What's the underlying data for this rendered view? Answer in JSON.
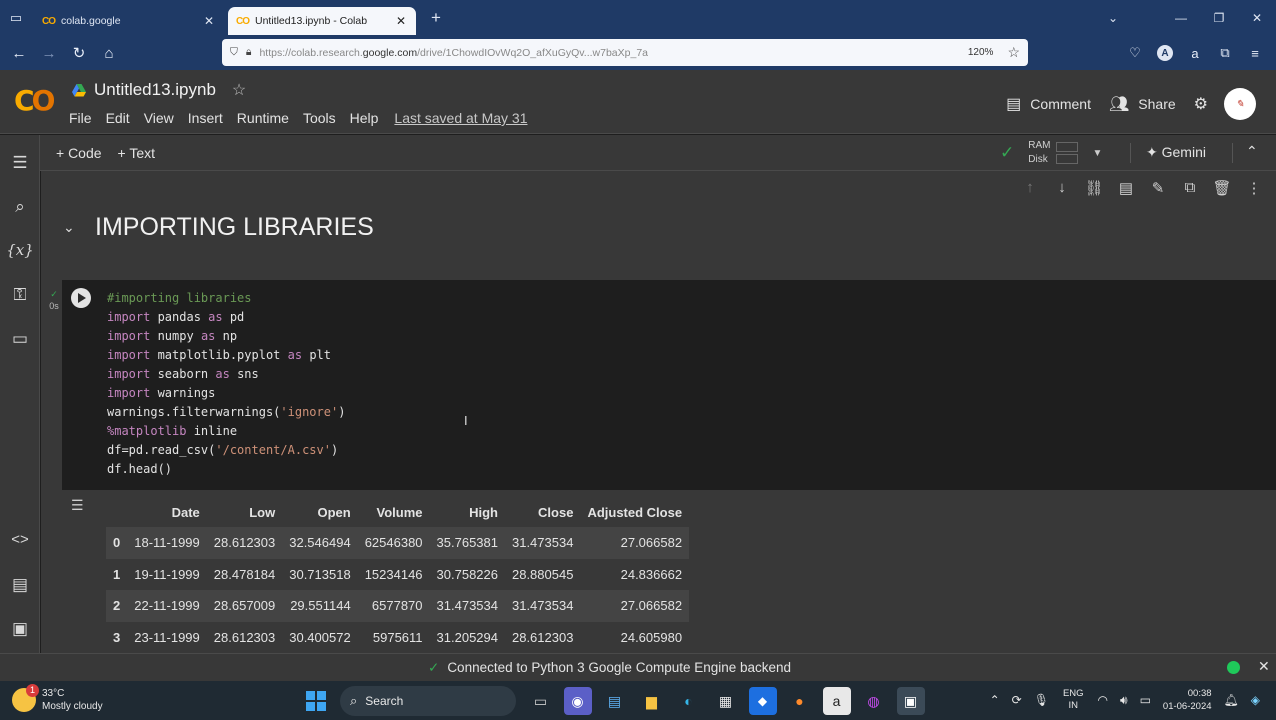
{
  "browser": {
    "tabs": [
      {
        "favicon": "colab-logo",
        "label": "colab.google",
        "active": false
      },
      {
        "favicon": "colab-logo",
        "label": "Untitled13.ipynb - Colab",
        "active": true
      }
    ],
    "url": {
      "prefix": "https://colab.research.",
      "domain": "google.com",
      "rest": "/drive/1ChowdIOvWq2O_afXuGyQv...w7baXp_7a"
    },
    "zoom": "120%"
  },
  "colab": {
    "notebook_title": "Untitled13.ipynb",
    "menu": [
      "File",
      "Edit",
      "View",
      "Insert",
      "Runtime",
      "Tools",
      "Help"
    ],
    "last_saved": "Last saved at May 31",
    "comment_label": "Comment",
    "share_label": "Share",
    "toolbar": {
      "add_code": "+ Code",
      "add_text": "+ Text",
      "ram_label": "RAM",
      "disk_label": "Disk",
      "gemini_label": "Gemini"
    }
  },
  "section_heading": "IMPORTING LIBRARIES",
  "code_cell": {
    "exec_time": "0s",
    "lines": [
      "#importing libraries",
      "import pandas as pd",
      "import numpy as np",
      "import matplotlib.pyplot as plt",
      "import seaborn as sns",
      "import warnings",
      "warnings.filterwarnings('ignore')",
      "%matplotlib inline",
      "df=pd.read_csv('/content/A.csv')",
      "df.head()"
    ]
  },
  "output_table": {
    "columns": [
      "",
      "Date",
      "Low",
      "Open",
      "Volume",
      "High",
      "Close",
      "Adjusted Close"
    ],
    "rows": [
      [
        "0",
        "18-11-1999",
        "28.612303",
        "32.546494",
        "62546380",
        "35.765381",
        "31.473534",
        "27.066582"
      ],
      [
        "1",
        "19-11-1999",
        "28.478184",
        "30.713518",
        "15234146",
        "30.758226",
        "28.880545",
        "24.836662"
      ],
      [
        "2",
        "22-11-1999",
        "28.657009",
        "29.551144",
        "6577870",
        "31.473534",
        "31.473534",
        "27.066582"
      ],
      [
        "3",
        "23-11-1999",
        "28.612303",
        "30.400572",
        "5975611",
        "31.205294",
        "28.612303",
        "24.605980"
      ]
    ]
  },
  "status": {
    "message": "Connected to Python 3 Google Compute Engine backend"
  },
  "taskbar": {
    "weather_badge": "1",
    "temperature": "33°C",
    "condition": "Mostly cloudy",
    "search_label": "Search",
    "lang_line1": "ENG",
    "lang_line2": "IN",
    "time": "00:38",
    "date": "01-06-2024"
  },
  "colors": {
    "accent_green": "#34a853",
    "browser_frame": "#1f3a66",
    "colab_orange": "#f9ab00"
  }
}
